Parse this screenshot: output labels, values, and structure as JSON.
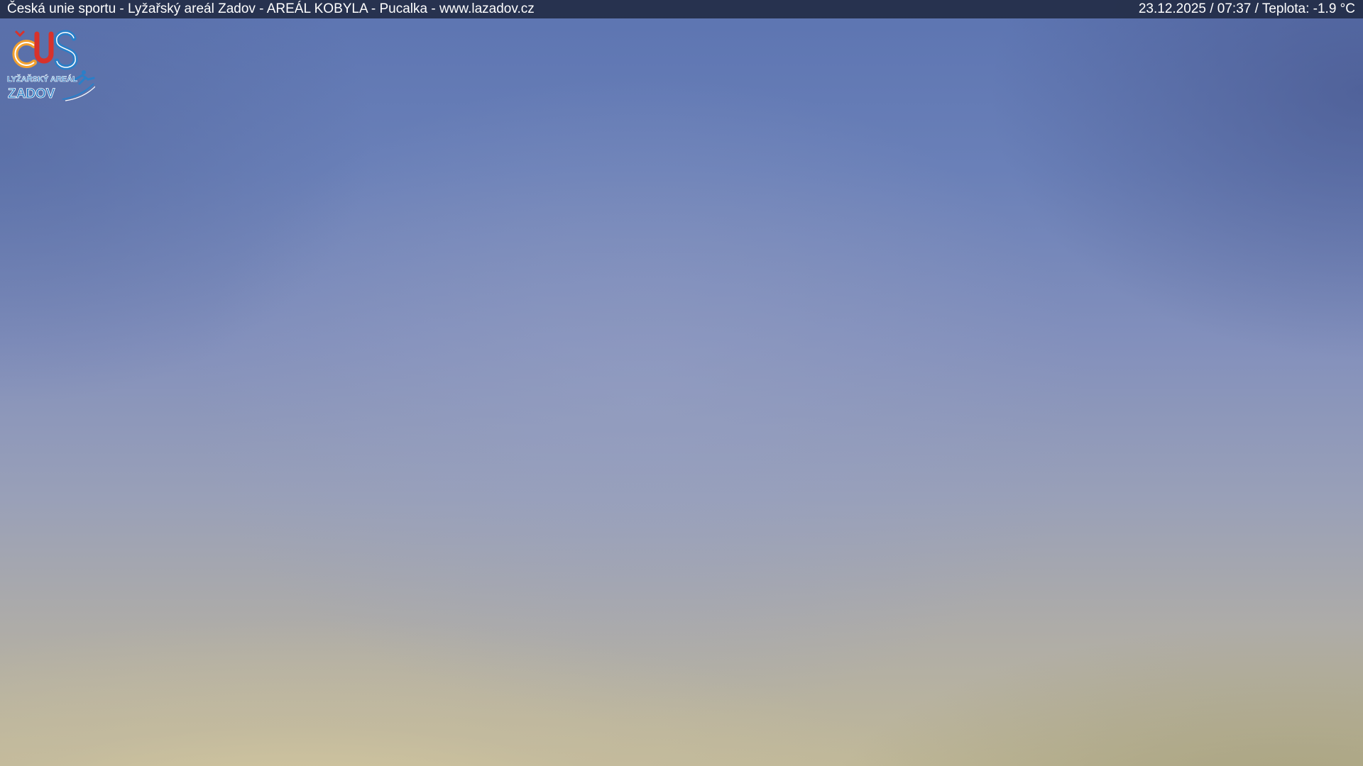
{
  "overlay": {
    "title": "Česká unie sportu - Lyžařský areál Zadov - AREÁL KOBYLA - Pucalka - www.lazadov.cz",
    "status": "23.12.2025 / 07:37 / Teplota: -1.9 °C"
  },
  "logo": {
    "monogram": "ČUS",
    "line1": "LYŽAŘSKÝ AREÁL",
    "line2": "ZADOV"
  },
  "colors": {
    "bar": "#232d46",
    "text": "#ffffff",
    "logo_orange": "#f0a030",
    "logo_blue": "#2a7fc8",
    "logo_red": "#d8322b"
  }
}
